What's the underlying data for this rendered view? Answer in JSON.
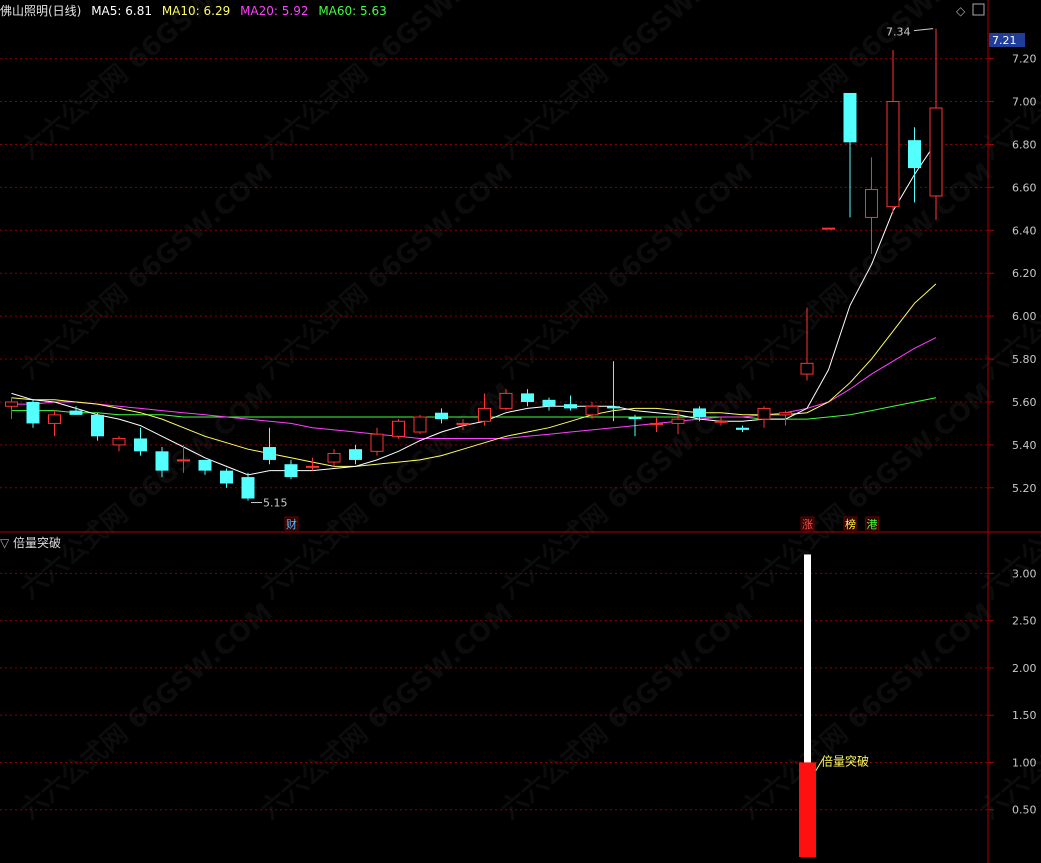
{
  "header": {
    "stock": "佛山照明(日线)",
    "ma5_label": "MA5: 6.81",
    "ma10_label": "MA10: 6.29",
    "ma20_label": "MA20: 5.92",
    "ma60_label": "MA60: 5.63"
  },
  "sub_panel": {
    "title": "倍量突破"
  },
  "current_price_tag": "7.21",
  "colors": {
    "up": "#ff3232",
    "down": "#54ffff",
    "ma5": "#ffffff",
    "ma10": "#ffff60",
    "ma20": "#ff40ff",
    "ma60": "#40ff40",
    "grid": "#8b0000",
    "axis": "#b00000",
    "price_tag_bg": "#1f3d99"
  },
  "chart_data": [
    {
      "type": "candlestick",
      "ylim": [
        5.05,
        7.38
      ],
      "yticks": [
        "5.20",
        "5.40",
        "5.60",
        "5.80",
        "6.00",
        "6.20",
        "6.40",
        "6.60",
        "6.80",
        "7.00",
        "7.20"
      ],
      "candles": [
        {
          "o": 5.58,
          "h": 5.62,
          "l": 5.52,
          "c": 5.6
        },
        {
          "o": 5.6,
          "h": 5.61,
          "l": 5.48,
          "c": 5.5
        },
        {
          "o": 5.5,
          "h": 5.56,
          "l": 5.44,
          "c": 5.54
        },
        {
          "o": 5.56,
          "h": 5.58,
          "l": 5.54,
          "c": 5.54
        },
        {
          "o": 5.54,
          "h": 5.55,
          "l": 5.42,
          "c": 5.44
        },
        {
          "o": 5.4,
          "h": 5.44,
          "l": 5.37,
          "c": 5.43
        },
        {
          "o": 5.43,
          "h": 5.48,
          "l": 5.35,
          "c": 5.37
        },
        {
          "o": 5.37,
          "h": 5.39,
          "l": 5.25,
          "c": 5.28
        },
        {
          "o": 5.33,
          "h": 5.4,
          "l": 5.27,
          "c": 5.33
        },
        {
          "o": 5.33,
          "h": 5.33,
          "l": 5.26,
          "c": 5.28
        },
        {
          "o": 5.28,
          "h": 5.29,
          "l": 5.2,
          "c": 5.22
        },
        {
          "o": 5.25,
          "h": 5.27,
          "l": 5.14,
          "c": 5.15
        },
        {
          "o": 5.39,
          "h": 5.48,
          "l": 5.31,
          "c": 5.33
        },
        {
          "o": 5.31,
          "h": 5.33,
          "l": 5.24,
          "c": 5.25
        },
        {
          "o": 5.3,
          "h": 5.34,
          "l": 5.28,
          "c": 5.3
        },
        {
          "o": 5.32,
          "h": 5.38,
          "l": 5.3,
          "c": 5.36
        },
        {
          "o": 5.38,
          "h": 5.4,
          "l": 5.31,
          "c": 5.33
        },
        {
          "o": 5.37,
          "h": 5.48,
          "l": 5.35,
          "c": 5.45
        },
        {
          "o": 5.44,
          "h": 5.52,
          "l": 5.43,
          "c": 5.51
        },
        {
          "o": 5.46,
          "h": 5.54,
          "l": 5.45,
          "c": 5.53
        },
        {
          "o": 5.55,
          "h": 5.57,
          "l": 5.5,
          "c": 5.52
        },
        {
          "o": 5.5,
          "h": 5.52,
          "l": 5.47,
          "c": 5.5
        },
        {
          "o": 5.51,
          "h": 5.64,
          "l": 5.49,
          "c": 5.57
        },
        {
          "o": 5.57,
          "h": 5.66,
          "l": 5.56,
          "c": 5.64
        },
        {
          "o": 5.64,
          "h": 5.66,
          "l": 5.58,
          "c": 5.6
        },
        {
          "o": 5.61,
          "h": 5.62,
          "l": 5.56,
          "c": 5.58
        },
        {
          "o": 5.59,
          "h": 5.63,
          "l": 5.56,
          "c": 5.57
        },
        {
          "o": 5.54,
          "h": 5.6,
          "l": 5.52,
          "c": 5.58
        },
        {
          "o": 5.58,
          "h": 5.79,
          "l": 5.51,
          "c": 5.57
        },
        {
          "o": 5.53,
          "h": 5.54,
          "l": 5.44,
          "c": 5.52
        },
        {
          "o": 5.5,
          "h": 5.53,
          "l": 5.46,
          "c": 5.5
        },
        {
          "o": 5.5,
          "h": 5.56,
          "l": 5.45,
          "c": 5.52
        },
        {
          "o": 5.57,
          "h": 5.58,
          "l": 5.51,
          "c": 5.53
        },
        {
          "o": 5.51,
          "h": 5.53,
          "l": 5.49,
          "c": 5.51
        },
        {
          "o": 5.48,
          "h": 5.49,
          "l": 5.46,
          "c": 5.47
        },
        {
          "o": 5.52,
          "h": 5.58,
          "l": 5.48,
          "c": 5.57
        },
        {
          "o": 5.54,
          "h": 5.56,
          "l": 5.49,
          "c": 5.55
        },
        {
          "o": 5.73,
          "h": 6.04,
          "l": 5.7,
          "c": 5.78
        },
        {
          "o": 6.41,
          "h": 6.41,
          "l": 6.41,
          "c": 6.41
        },
        {
          "o": 7.04,
          "h": 7.04,
          "l": 6.46,
          "c": 6.81
        },
        {
          "o": 6.46,
          "h": 6.74,
          "l": 6.29,
          "c": 6.59
        },
        {
          "o": 6.51,
          "h": 7.24,
          "l": 6.48,
          "c": 7.0
        },
        {
          "o": 6.82,
          "h": 6.88,
          "l": 6.53,
          "c": 6.69
        },
        {
          "o": 6.56,
          "h": 7.34,
          "l": 6.45,
          "c": 6.97
        }
      ],
      "ma5": [
        5.64,
        5.61,
        5.6,
        5.57,
        5.54,
        5.52,
        5.49,
        5.44,
        5.39,
        5.34,
        5.3,
        5.26,
        5.28,
        5.28,
        5.28,
        5.29,
        5.3,
        5.33,
        5.37,
        5.42,
        5.46,
        5.49,
        5.51,
        5.55,
        5.57,
        5.58,
        5.58,
        5.58,
        5.58,
        5.56,
        5.55,
        5.54,
        5.52,
        5.51,
        5.51,
        5.52,
        5.52,
        5.57,
        5.75,
        6.05,
        6.24,
        6.49,
        6.66,
        6.81
      ],
      "ma10": [
        5.62,
        5.61,
        5.61,
        5.6,
        5.59,
        5.57,
        5.55,
        5.52,
        5.48,
        5.44,
        5.41,
        5.38,
        5.36,
        5.34,
        5.32,
        5.3,
        5.3,
        5.31,
        5.32,
        5.33,
        5.35,
        5.38,
        5.41,
        5.44,
        5.46,
        5.48,
        5.51,
        5.54,
        5.56,
        5.57,
        5.57,
        5.56,
        5.55,
        5.55,
        5.54,
        5.54,
        5.54,
        5.55,
        5.6,
        5.69,
        5.8,
        5.93,
        6.06,
        6.15
      ],
      "ma20": [
        5.59,
        5.59,
        5.6,
        5.6,
        5.59,
        5.58,
        5.57,
        5.56,
        5.55,
        5.54,
        5.53,
        5.52,
        5.51,
        5.5,
        5.48,
        5.47,
        5.46,
        5.45,
        5.44,
        5.43,
        5.43,
        5.43,
        5.43,
        5.43,
        5.44,
        5.45,
        5.46,
        5.47,
        5.48,
        5.49,
        5.5,
        5.51,
        5.52,
        5.53,
        5.53,
        5.54,
        5.55,
        5.57,
        5.6,
        5.66,
        5.73,
        5.79,
        5.85,
        5.9
      ],
      "ma60": [
        5.56,
        5.56,
        5.56,
        5.55,
        5.55,
        5.54,
        5.54,
        5.54,
        5.53,
        5.53,
        5.53,
        5.53,
        5.53,
        5.53,
        5.53,
        5.53,
        5.53,
        5.53,
        5.53,
        5.53,
        5.53,
        5.53,
        5.53,
        5.53,
        5.53,
        5.53,
        5.53,
        5.53,
        5.53,
        5.53,
        5.53,
        5.53,
        5.53,
        5.53,
        5.53,
        5.52,
        5.52,
        5.52,
        5.53,
        5.54,
        5.56,
        5.58,
        5.6,
        5.62
      ],
      "annotations": [
        {
          "index": 11,
          "price": 5.15,
          "text": "5.15"
        },
        {
          "index": 43,
          "price": 7.34,
          "text": "7.34"
        }
      ],
      "markers": [
        {
          "index": 13,
          "text": "财",
          "color": "#54c0ff"
        },
        {
          "index": 37,
          "text": "涨",
          "color": "#ff5050"
        },
        {
          "index": 39,
          "text": "榜",
          "color": "#ffff40"
        },
        {
          "index": 40,
          "text": "港",
          "color": "#40ff40"
        }
      ]
    },
    {
      "type": "bar",
      "title": "倍量突破",
      "ylim": [
        0,
        3.3
      ],
      "yticks": [
        "0.50",
        "1.00",
        "1.50",
        "2.00",
        "2.50",
        "3.00"
      ],
      "bars": [
        {
          "index": 37,
          "value": 3.2,
          "highlight": 1.0,
          "label": "倍量突破"
        }
      ]
    }
  ]
}
